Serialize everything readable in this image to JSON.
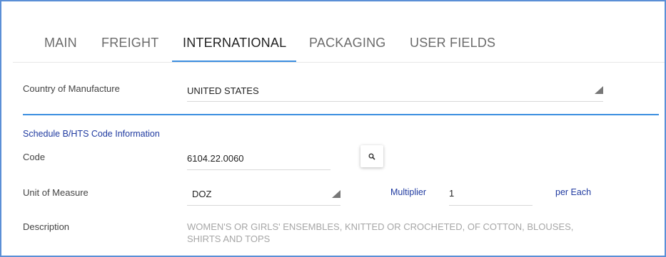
{
  "tabs": [
    {
      "label": "MAIN",
      "active": false
    },
    {
      "label": "FREIGHT",
      "active": false
    },
    {
      "label": "INTERNATIONAL",
      "active": true
    },
    {
      "label": "PACKAGING",
      "active": false
    },
    {
      "label": "USER FIELDS",
      "active": false
    }
  ],
  "country": {
    "label": "Country of Manufacture",
    "value": "UNITED STATES"
  },
  "hts_section": {
    "title": "Schedule B/HTS Code Information",
    "code_label": "Code",
    "code_value": "6104.22.0060",
    "search_icon": "search-icon",
    "uom_label": "Unit of Measure",
    "uom_value": "DOZ",
    "multiplier_label": "Multiplier",
    "multiplier_value": "1",
    "per_label": "per Each",
    "description_label": "Description",
    "description_value": "WOMEN'S OR GIRLS' ENSEMBLES, KNITTED OR CROCHETED, OF COTTON, BLOUSES, SHIRTS AND TOPS"
  },
  "colors": {
    "accent": "#3b8ee0",
    "link_blue": "#1f3aa0",
    "frame": "#5b8fd6"
  }
}
